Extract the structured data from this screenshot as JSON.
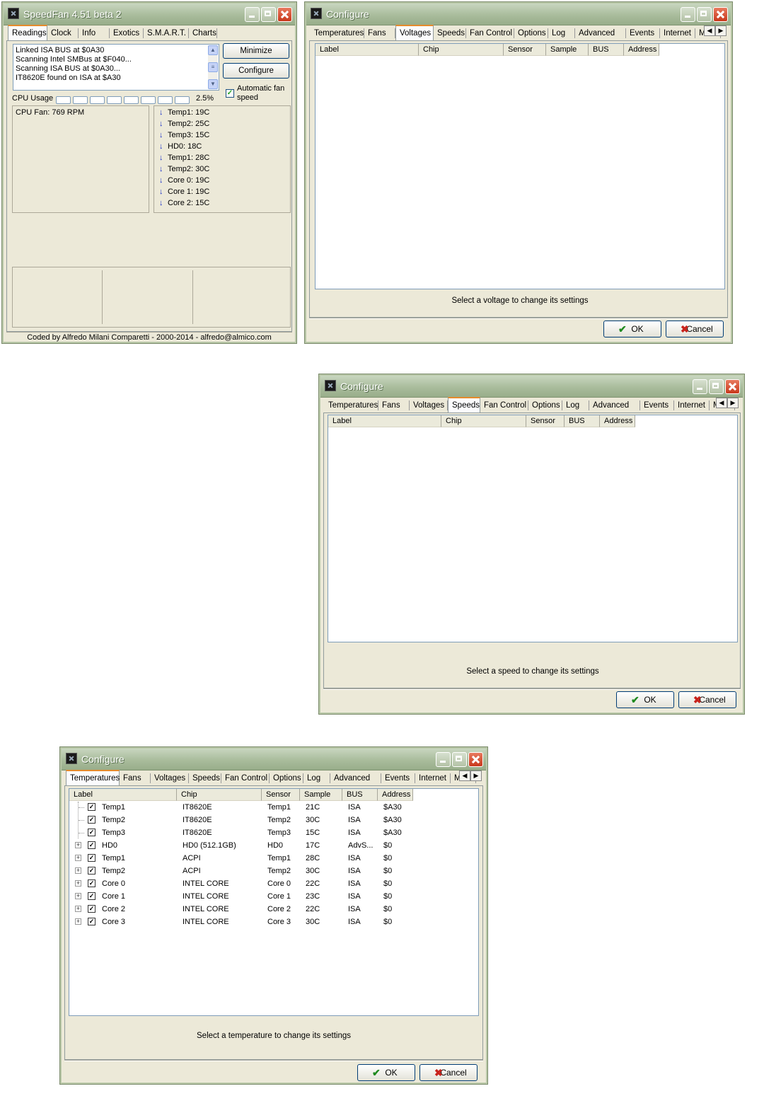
{
  "main_window": {
    "title": "SpeedFan 4.51 beta 2",
    "tabs": [
      "Readings",
      "Clock",
      "Info",
      "Exotics",
      "S.M.A.R.T.",
      "Charts"
    ],
    "active_tab": "Readings",
    "log_lines": [
      "Linked ISA BUS at $0A30",
      "Scanning Intel SMBus at $F040...",
      "Scanning ISA BUS at $0A30...",
      "IT8620E found on ISA at $A30"
    ],
    "minimize_label": "Minimize",
    "configure_label": "Configure",
    "auto_fan_label": "Automatic fan speed",
    "auto_fan_checked": true,
    "cpu_usage_label": "CPU Usage",
    "cpu_usage_value": "2.5%",
    "fan_reading": "CPU Fan: 769 RPM",
    "temp_readings": [
      "Temp1: 19C",
      "Temp2: 25C",
      "Temp3: 15C",
      "HD0:    18C",
      "Temp1: 28C",
      "Temp2: 30C",
      "Core 0: 19C",
      "Core 1: 19C",
      "Core 2: 15C"
    ],
    "status_bar": "Coded by Alfredo Milani Comparetti - 2000-2014 - alfredo@almico.com"
  },
  "config_tabs": [
    "Temperatures",
    "Fans",
    "Voltages",
    "Speeds",
    "Fan Control",
    "Options",
    "Log",
    "Advanced",
    "Events",
    "Internet",
    "Mail"
  ],
  "voltages_window": {
    "title": "Configure",
    "active_tab": "Voltages",
    "columns": [
      "Label",
      "Chip",
      "Sensor",
      "Sample",
      "BUS",
      "Address"
    ],
    "hint": "Select a voltage to change its settings",
    "ok_label": "OK",
    "cancel_label": "Cancel"
  },
  "speeds_window": {
    "title": "Configure",
    "active_tab": "Speeds",
    "columns": [
      "Label",
      "Chip",
      "Sensor",
      "BUS",
      "Address"
    ],
    "hint": "Select a speed to change its settings",
    "ok_label": "OK",
    "cancel_label": "Cancel"
  },
  "temperatures_window": {
    "title": "Configure",
    "active_tab": "Temperatures",
    "columns": [
      "Label",
      "Chip",
      "Sensor",
      "Sample",
      "BUS",
      "Address"
    ],
    "rows": [
      {
        "expandable": false,
        "checked": true,
        "label": "Temp1",
        "chip": "IT8620E",
        "sensor": "Temp1",
        "sample": "21C",
        "bus": "ISA",
        "address": "$A30"
      },
      {
        "expandable": false,
        "checked": true,
        "label": "Temp2",
        "chip": "IT8620E",
        "sensor": "Temp2",
        "sample": "30C",
        "bus": "ISA",
        "address": "$A30"
      },
      {
        "expandable": false,
        "checked": true,
        "label": "Temp3",
        "chip": "IT8620E",
        "sensor": "Temp3",
        "sample": "15C",
        "bus": "ISA",
        "address": "$A30"
      },
      {
        "expandable": true,
        "checked": true,
        "label": "HD0",
        "chip": "HD0 (512.1GB)",
        "sensor": "HD0",
        "sample": "17C",
        "bus": "AdvS...",
        "address": "$0"
      },
      {
        "expandable": true,
        "checked": true,
        "label": "Temp1",
        "chip": "ACPI",
        "sensor": "Temp1",
        "sample": "28C",
        "bus": "ISA",
        "address": "$0"
      },
      {
        "expandable": true,
        "checked": true,
        "label": "Temp2",
        "chip": "ACPI",
        "sensor": "Temp2",
        "sample": "30C",
        "bus": "ISA",
        "address": "$0"
      },
      {
        "expandable": true,
        "checked": true,
        "label": "Core 0",
        "chip": "INTEL CORE",
        "sensor": "Core 0",
        "sample": "22C",
        "bus": "ISA",
        "address": "$0"
      },
      {
        "expandable": true,
        "checked": true,
        "label": "Core 1",
        "chip": "INTEL CORE",
        "sensor": "Core 1",
        "sample": "23C",
        "bus": "ISA",
        "address": "$0"
      },
      {
        "expandable": true,
        "checked": true,
        "label": "Core 2",
        "chip": "INTEL CORE",
        "sensor": "Core 2",
        "sample": "22C",
        "bus": "ISA",
        "address": "$0"
      },
      {
        "expandable": true,
        "checked": true,
        "label": "Core 3",
        "chip": "INTEL CORE",
        "sensor": "Core 3",
        "sample": "30C",
        "bus": "ISA",
        "address": "$0"
      }
    ],
    "hint": "Select a temperature to change its settings",
    "ok_label": "OK",
    "cancel_label": "Cancel"
  }
}
